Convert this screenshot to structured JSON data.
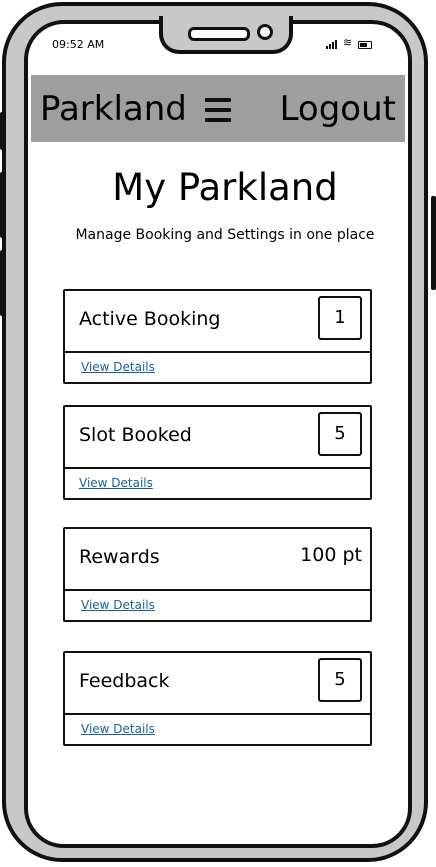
{
  "status_bar": {
    "time": "09:52 AM"
  },
  "navbar": {
    "brand": "Parkland",
    "logout": "Logout"
  },
  "page": {
    "title": "My Parkland",
    "subtitle": "Manage Booking and Settings in one place"
  },
  "cards": [
    {
      "label": "Active Booking",
      "value": "1",
      "link": "View Details"
    },
    {
      "label": "Slot Booked",
      "value": "5",
      "link": "View Details"
    },
    {
      "label": "Rewards",
      "value": "100 pt",
      "link": "View Details"
    },
    {
      "label": "Feedback",
      "value": "5",
      "link": "View Details"
    }
  ],
  "colors": {
    "navbar_bg": "#9e9e9e",
    "link": "#1a5f9e",
    "phone_frame": "#c8c8c8"
  }
}
